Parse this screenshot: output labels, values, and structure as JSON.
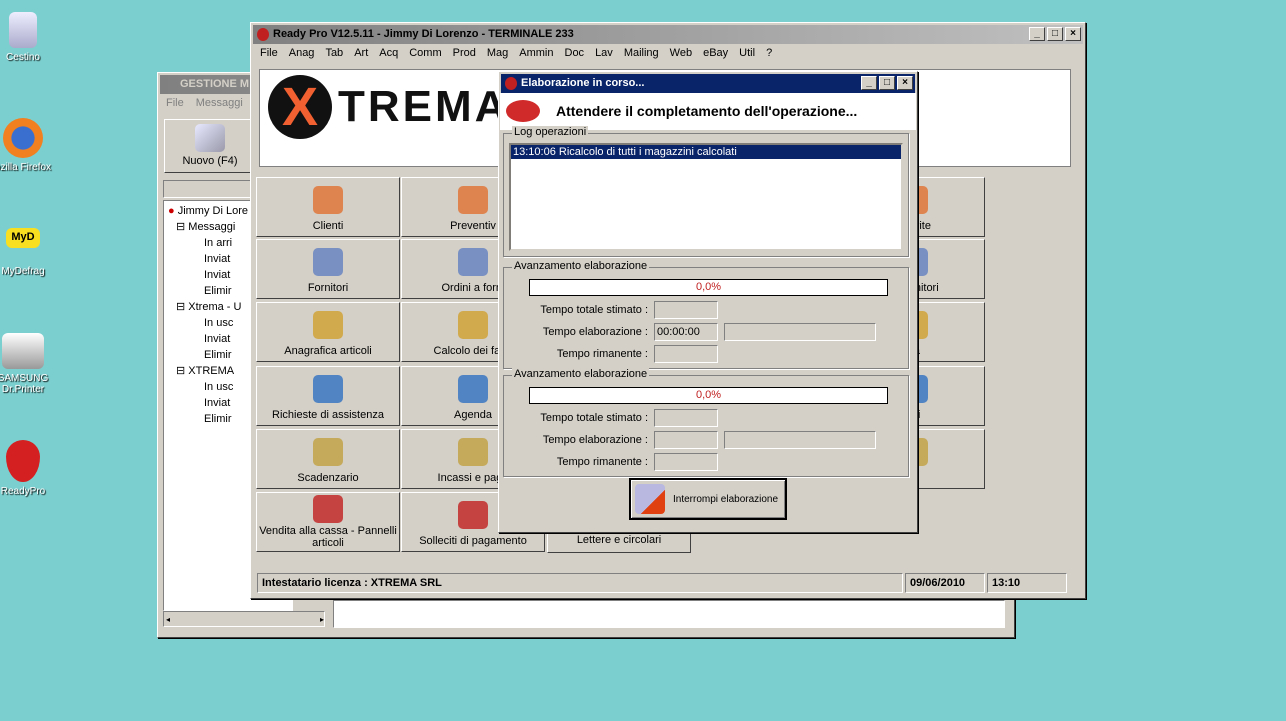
{
  "desktop": {
    "icons": [
      {
        "label": "Cestino"
      },
      {
        "label": "ozilla Firefox"
      },
      {
        "label": "MyDefrag"
      },
      {
        "label": "SAMSUNG Dr.Printer"
      },
      {
        "label": "ReadyPro"
      }
    ],
    "mydefrag_badge": "MyD"
  },
  "mail_window": {
    "title": "GESTIONE M",
    "menu": [
      "File",
      "Messaggi"
    ],
    "new_button": "Nuovo (F4)",
    "tree": [
      "Jimmy Di Lore",
      "Messaggi",
      "In arri",
      "Inviat",
      "Inviat",
      "Elimir",
      "Xtrema - U",
      "In usc",
      "Inviat",
      "Elimir",
      "XTREMA",
      "In usc",
      "Inviat",
      "Elimir"
    ]
  },
  "main_window": {
    "title": "Ready Pro V12.5.11 - Jimmy Di Lorenzo - TERMINALE 233",
    "menu": [
      "File",
      "Anag",
      "Tab",
      "Art",
      "Acq",
      "Comm",
      "Prod",
      "Mag",
      "Ammin",
      "Doc",
      "Lav",
      "Mailing",
      "Web",
      "eBay",
      "Util",
      "?"
    ],
    "logo_text": "XTREMA",
    "grid": [
      [
        "Clienti",
        "Preventiv",
        "differite"
      ],
      [
        "Fornitori",
        "Ordini a forni",
        "ite fornitori"
      ],
      [
        "Anagrafica articoli",
        "Calcolo dei fabb",
        "ica"
      ],
      [
        "Richieste di assistenza",
        "Agenda",
        "atti"
      ],
      [
        "Scadenzario",
        "Incassi e paga",
        "nti"
      ],
      [
        "Vendita alla cassa - Pannelli articoli",
        "Solleciti di pagamento",
        "Lettere e circolari"
      ]
    ],
    "status": {
      "license": "Intestatario licenza : XTREMA SRL",
      "date": "09/06/2010",
      "time": "13:10"
    }
  },
  "dialog": {
    "title": "Elaborazione in corso...",
    "header": "Attendere il completamento dell'operazione...",
    "log_label": "Log operazioni",
    "log_entries": [
      "13:10:06 Ricalcolo di tutti i magazzini calcolati"
    ],
    "progress": [
      {
        "label": "Avanzamento elaborazione",
        "percent_text": "0,0%",
        "percent": 0,
        "total_label": "Tempo totale stimato :",
        "total": "",
        "elapsed_label": "Tempo elaborazione :",
        "elapsed": "00:00:00",
        "remaining_label": "Tempo rimanente :",
        "remaining": ""
      },
      {
        "label": "Avanzamento elaborazione",
        "percent_text": "0,0%",
        "percent": 0,
        "total_label": "Tempo totale stimato :",
        "total": "",
        "elapsed_label": "Tempo elaborazione :",
        "elapsed": "",
        "remaining_label": "Tempo rimanente :",
        "remaining": ""
      }
    ],
    "stop_button": "Interrompi elaborazione"
  }
}
